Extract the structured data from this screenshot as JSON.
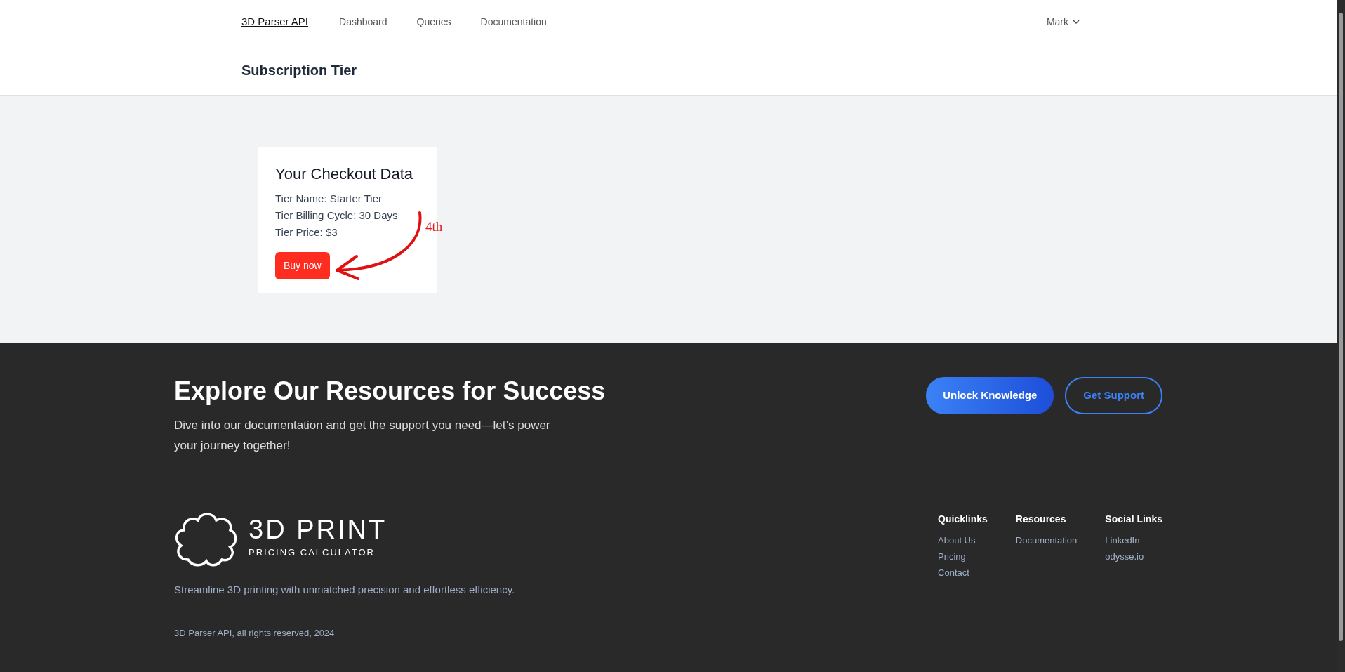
{
  "navbar": {
    "brand": "3D Parser API",
    "links": [
      {
        "label": "Dashboard"
      },
      {
        "label": "Queries"
      },
      {
        "label": "Documentation"
      }
    ],
    "user": {
      "label": "Mark"
    }
  },
  "page_header": {
    "title": "Subscription Tier"
  },
  "checkout_card": {
    "title": "Your Checkout Data",
    "lines": [
      "Tier Name: Starter Tier",
      "Tier Billing Cycle: 30 Days",
      "Tier Price: $3"
    ],
    "button": "Buy now"
  },
  "annotation": {
    "label": "4th"
  },
  "footer": {
    "heading": "Explore Our Resources for Success",
    "text": "Dive into our documentation and get the support you need—let’s power your journey together!",
    "buttons": [
      {
        "label": "Unlock Knowledge",
        "kind": "filled"
      },
      {
        "label": "Get Support",
        "kind": "outline"
      }
    ],
    "logo": {
      "title": "3D PRINT",
      "subtitle": "PRICING CALCULATOR"
    },
    "tagline": "Streamline 3D printing with unmatched precision and effortless efficiency.",
    "columns": [
      {
        "heading": "Quicklinks",
        "links": [
          "About Us",
          "Pricing",
          "Contact"
        ]
      },
      {
        "heading": "Resources",
        "links": [
          "Documentation"
        ]
      },
      {
        "heading": "Social Links",
        "links": [
          "LinkedIn",
          "odysse.io"
        ]
      }
    ],
    "copyright": "3D Parser API, all rights reserved, 2024"
  }
}
